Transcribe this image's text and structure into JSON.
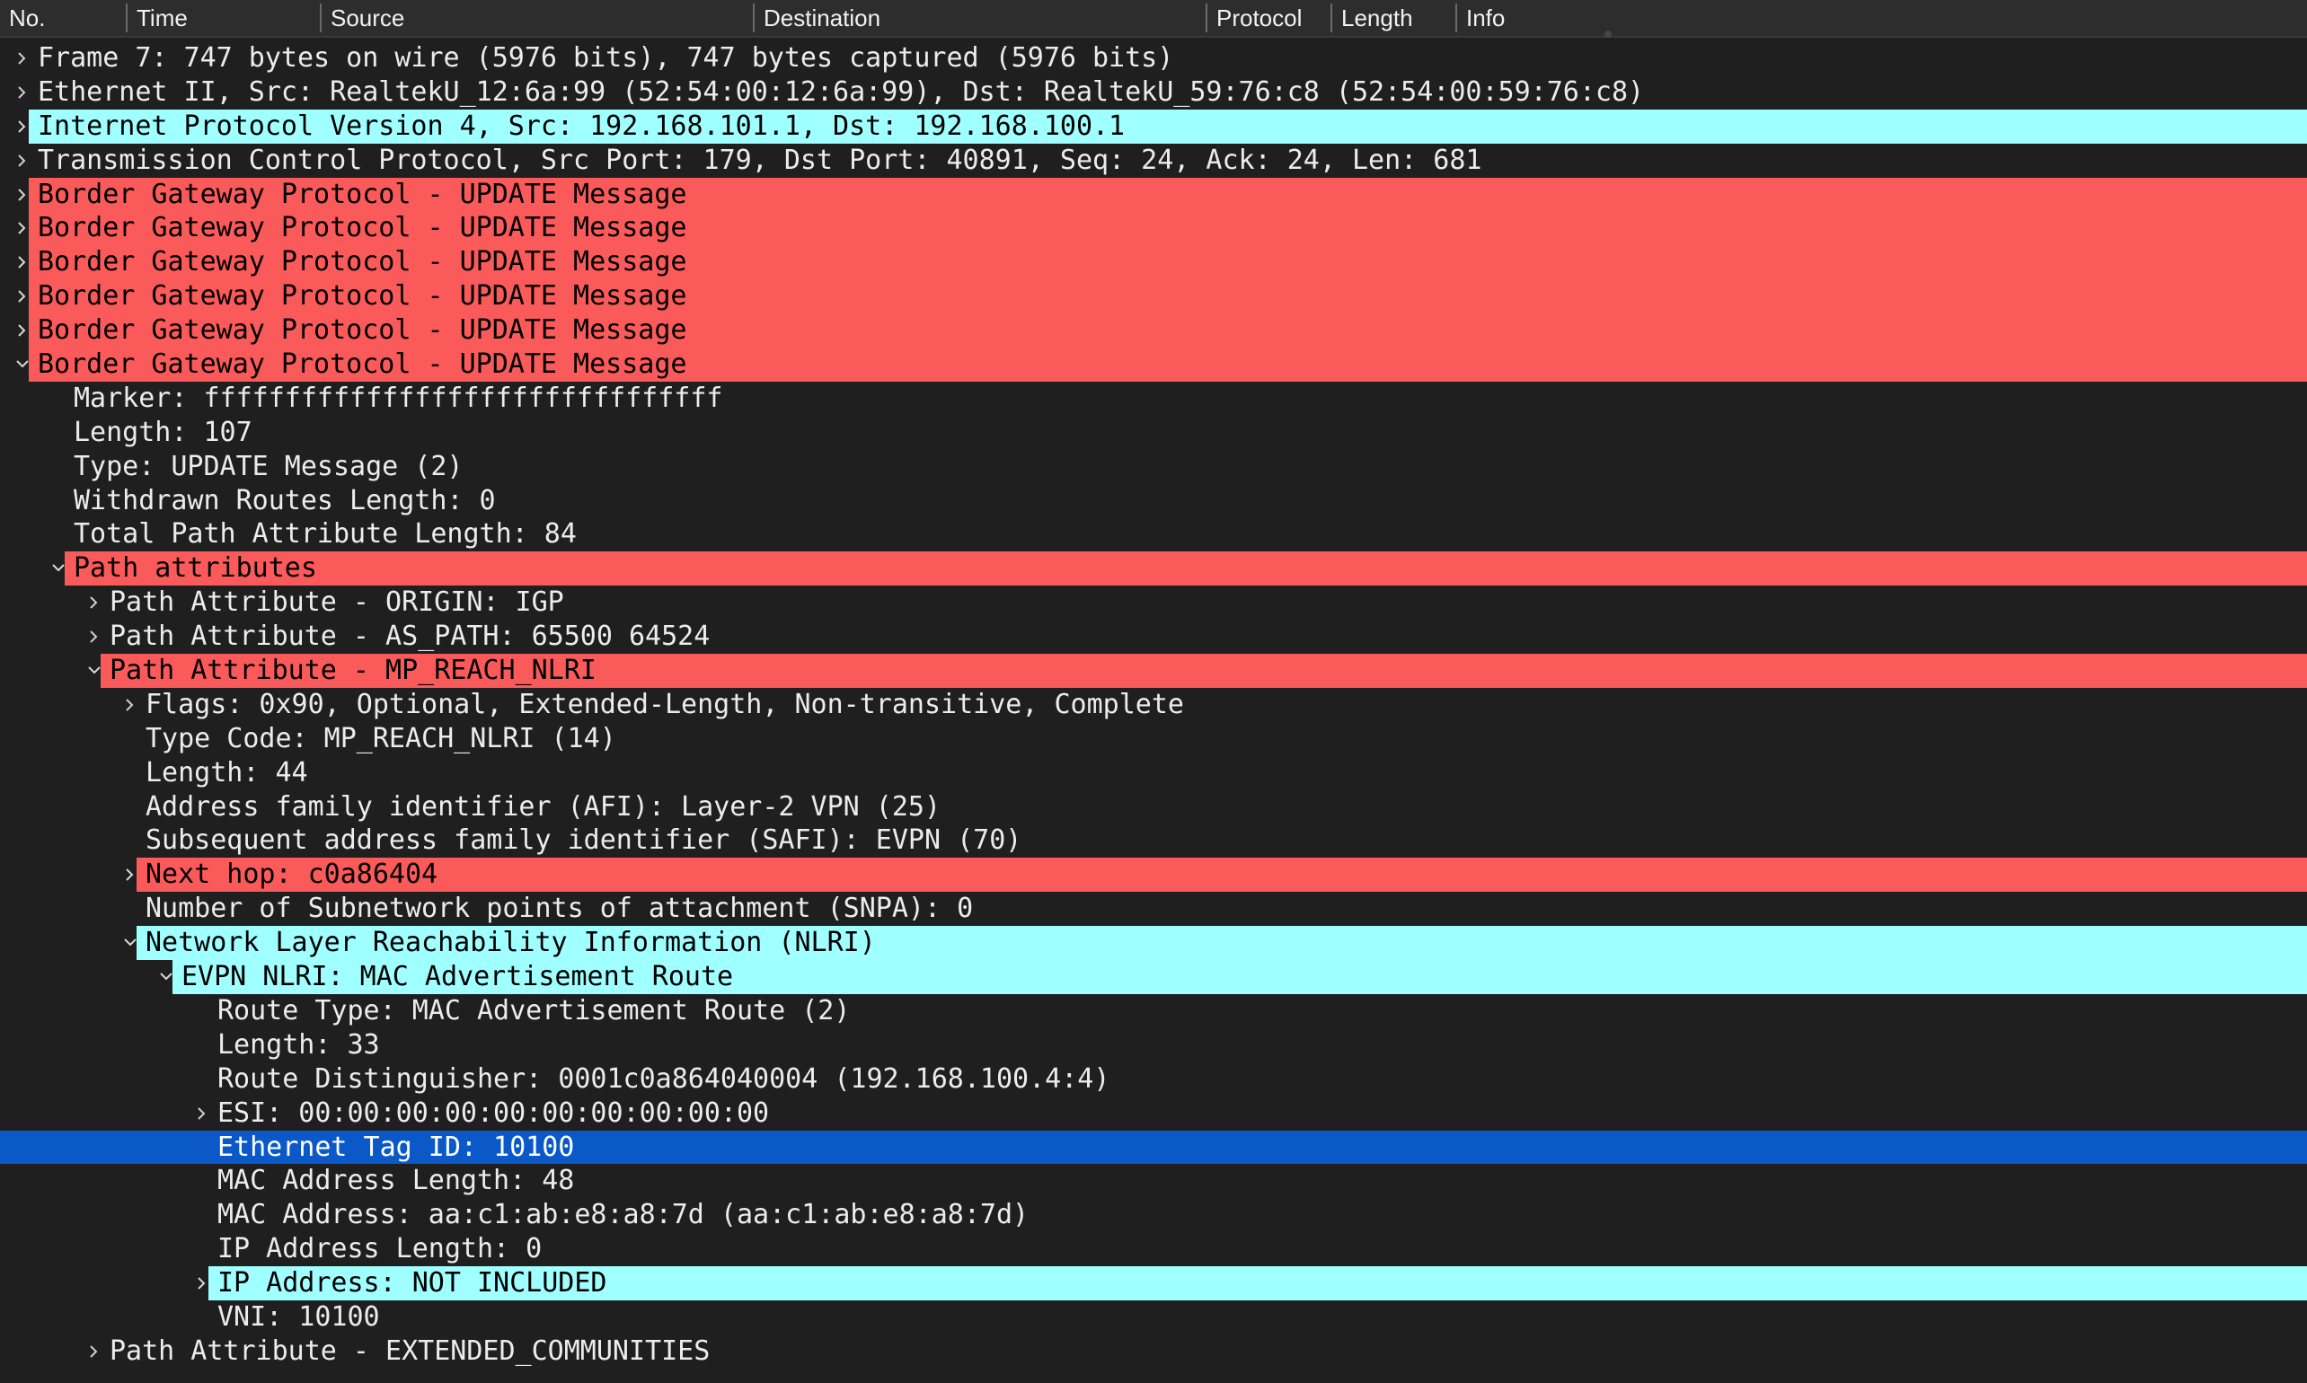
{
  "columns": [
    {
      "label": "No."
    },
    {
      "label": "Time"
    },
    {
      "label": "Source"
    },
    {
      "label": "Destination"
    },
    {
      "label": "Protocol"
    },
    {
      "label": "Length"
    },
    {
      "label": "Info"
    }
  ],
  "tree": [
    {
      "label": "Frame 7: 747 bytes on wire (5976 bits), 747 bytes captured (5976 bits)",
      "level": 0,
      "toggle": "collapsed"
    },
    {
      "label": "Ethernet II, Src: RealtekU_12:6a:99 (52:54:00:12:6a:99), Dst: RealtekU_59:76:c8 (52:54:00:59:76:c8)",
      "level": 0,
      "toggle": "collapsed"
    },
    {
      "label": "Internet Protocol Version 4, Src: 192.168.101.1, Dst: 192.168.100.1",
      "level": 0,
      "toggle": "collapsed",
      "bg": "cyan"
    },
    {
      "label": "Transmission Control Protocol, Src Port: 179, Dst Port: 40891, Seq: 24, Ack: 24, Len: 681",
      "level": 0,
      "toggle": "collapsed"
    },
    {
      "label": "Border Gateway Protocol - UPDATE Message",
      "level": 0,
      "toggle": "collapsed",
      "bg": "red"
    },
    {
      "label": "Border Gateway Protocol - UPDATE Message",
      "level": 0,
      "toggle": "collapsed",
      "bg": "red"
    },
    {
      "label": "Border Gateway Protocol - UPDATE Message",
      "level": 0,
      "toggle": "collapsed",
      "bg": "red"
    },
    {
      "label": "Border Gateway Protocol - UPDATE Message",
      "level": 0,
      "toggle": "collapsed",
      "bg": "red"
    },
    {
      "label": "Border Gateway Protocol - UPDATE Message",
      "level": 0,
      "toggle": "collapsed",
      "bg": "red"
    },
    {
      "label": "Border Gateway Protocol - UPDATE Message",
      "level": 0,
      "toggle": "expanded",
      "bg": "red"
    },
    {
      "label": "Marker: ffffffffffffffffffffffffffffffff",
      "level": 1,
      "toggle": "none"
    },
    {
      "label": "Length: 107",
      "level": 1,
      "toggle": "none"
    },
    {
      "label": "Type: UPDATE Message (2)",
      "level": 1,
      "toggle": "none"
    },
    {
      "label": "Withdrawn Routes Length: 0",
      "level": 1,
      "toggle": "none"
    },
    {
      "label": "Total Path Attribute Length: 84",
      "level": 1,
      "toggle": "none"
    },
    {
      "label": "Path attributes",
      "level": 1,
      "toggle": "expanded",
      "bg": "red"
    },
    {
      "label": "Path Attribute - ORIGIN: IGP",
      "level": 2,
      "toggle": "collapsed"
    },
    {
      "label": "Path Attribute - AS_PATH: 65500 64524",
      "level": 2,
      "toggle": "collapsed"
    },
    {
      "label": "Path Attribute - MP_REACH_NLRI",
      "level": 2,
      "toggle": "expanded",
      "bg": "red"
    },
    {
      "label": "Flags: 0x90, Optional, Extended-Length, Non-transitive, Complete",
      "level": 3,
      "toggle": "collapsed"
    },
    {
      "label": "Type Code: MP_REACH_NLRI (14)",
      "level": 3,
      "toggle": "none"
    },
    {
      "label": "Length: 44",
      "level": 3,
      "toggle": "none"
    },
    {
      "label": "Address family identifier (AFI): Layer-2 VPN (25)",
      "level": 3,
      "toggle": "none"
    },
    {
      "label": "Subsequent address family identifier (SAFI): EVPN (70)",
      "level": 3,
      "toggle": "none"
    },
    {
      "label": "Next hop: c0a86404",
      "level": 3,
      "toggle": "collapsed",
      "bg": "red"
    },
    {
      "label": "Number of Subnetwork points of attachment (SNPA): 0",
      "level": 3,
      "toggle": "none"
    },
    {
      "label": "Network Layer Reachability Information (NLRI)",
      "level": 3,
      "toggle": "expanded",
      "bg": "cyan"
    },
    {
      "label": "EVPN NLRI: MAC Advertisement Route",
      "level": 4,
      "toggle": "expanded",
      "bg": "cyan"
    },
    {
      "label": "Route Type: MAC Advertisement Route (2)",
      "level": 5,
      "toggle": "none"
    },
    {
      "label": "Length: 33",
      "level": 5,
      "toggle": "none"
    },
    {
      "label": "Route Distinguisher: 0001c0a864040004 (192.168.100.4:4)",
      "level": 5,
      "toggle": "none"
    },
    {
      "label": "ESI: 00:00:00:00:00:00:00:00:00:00",
      "level": 5,
      "toggle": "collapsed"
    },
    {
      "label": "Ethernet Tag ID: 10100",
      "level": 5,
      "toggle": "none",
      "selected": true
    },
    {
      "label": "MAC Address Length: 48",
      "level": 5,
      "toggle": "none"
    },
    {
      "label": "MAC Address: aa:c1:ab:e8:a8:7d (aa:c1:ab:e8:a8:7d)",
      "level": 5,
      "toggle": "none"
    },
    {
      "label": "IP Address Length: 0",
      "level": 5,
      "toggle": "none"
    },
    {
      "label": "IP Address: NOT INCLUDED",
      "level": 5,
      "toggle": "collapsed",
      "bg": "cyan"
    },
    {
      "label": "VNI: 10100",
      "level": 5,
      "toggle": "none"
    },
    {
      "label": "Path Attribute - EXTENDED_COMMUNITIES",
      "level": 2,
      "toggle": "collapsed"
    }
  ],
  "colors": {
    "background": "#1f1f1f",
    "red_highlight": "#fa5a5a",
    "cyan_highlight": "#a0ffff",
    "selection": "#0b59c8"
  }
}
